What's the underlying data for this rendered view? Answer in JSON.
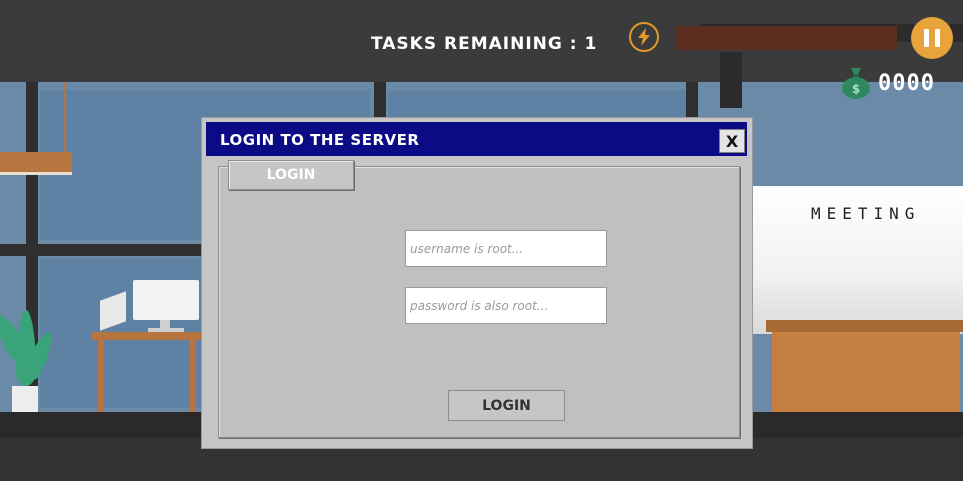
{
  "hud": {
    "tasks_remaining": "TASKS REMAINING : 1",
    "money": "0000",
    "energy_icon": "lightning-icon",
    "pause_icon": "pause-icon",
    "money_icon": "money-bag-icon",
    "colors": {
      "energy_bar": "#5b2e20",
      "pause": "#e8a43a",
      "energy_ring": "#e39a2a"
    }
  },
  "scene": {
    "meeting_sign": "MEETING"
  },
  "dialog": {
    "title": "LOGIN TO THE SERVER",
    "close_label": "X",
    "tab_label": "LOGIN",
    "username_placeholder": "username is root...",
    "password_placeholder": "password is also root...",
    "login_button": "LOGIN",
    "colors": {
      "title_bar": "#0b0b86",
      "body": "#c6c6c6"
    }
  }
}
